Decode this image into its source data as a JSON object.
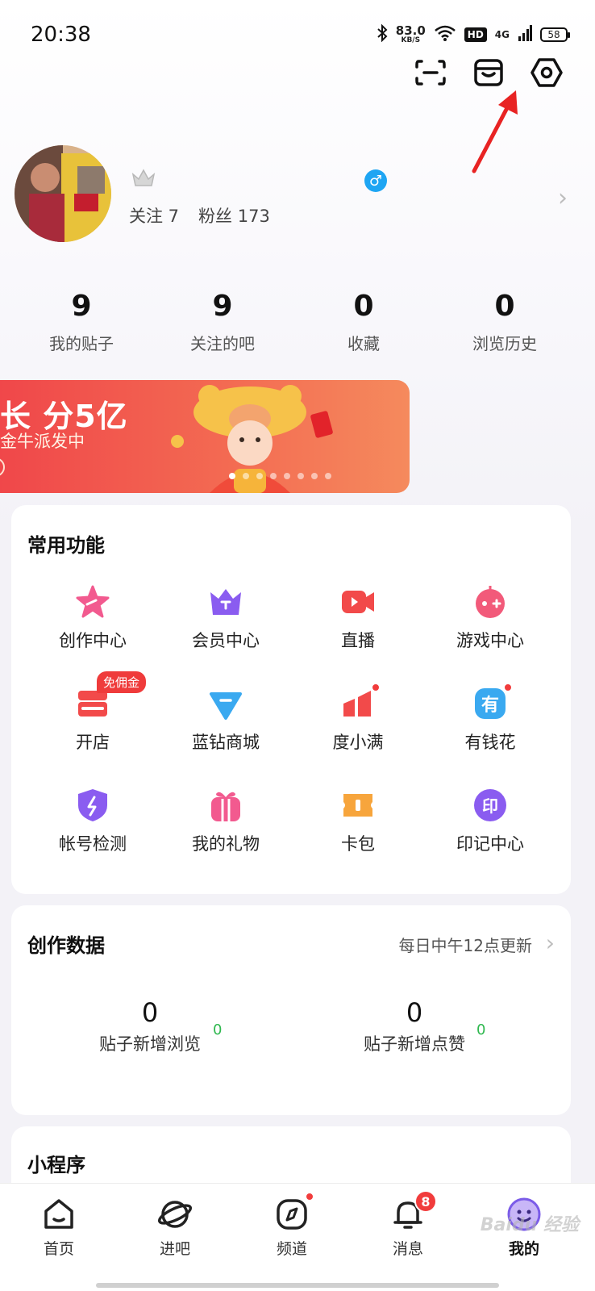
{
  "status_bar": {
    "time": "20:38",
    "speed_value": "83.0",
    "speed_unit": "KB/S",
    "hd": "HD",
    "network": "4G",
    "battery": "58"
  },
  "top_icons": [
    "scan-icon",
    "store-icon",
    "settings-icon"
  ],
  "profile": {
    "follow_label": "关注 7",
    "fans_label": "粉丝 173",
    "gender_symbol": "♂"
  },
  "stats": [
    {
      "value": "9",
      "label": "我的贴子"
    },
    {
      "value": "9",
      "label": "关注的吧"
    },
    {
      "value": "0",
      "label": "收藏"
    },
    {
      "value": "0",
      "label": "浏览历史"
    }
  ],
  "banner": {
    "title": "长 分5亿",
    "subtitle": "金牛派发中"
  },
  "functions": {
    "title": "常用功能",
    "promo_badge": "免佣金",
    "items": [
      {
        "label": "创作中心",
        "icon": "star-icon",
        "color": "#f25a8f"
      },
      {
        "label": "会员中心",
        "icon": "crown-icon",
        "color": "#8a5cf0"
      },
      {
        "label": "直播",
        "icon": "video-icon",
        "color": "#f24a4a"
      },
      {
        "label": "游戏中心",
        "icon": "gamepad-icon",
        "color": "#f25a7a"
      },
      {
        "label": "开店",
        "icon": "shop-icon",
        "color": "#f24a4a"
      },
      {
        "label": "蓝钻商城",
        "icon": "diamond-icon",
        "color": "#3aa9f0"
      },
      {
        "label": "度小满",
        "icon": "chart-icon",
        "color": "#f24a4a"
      },
      {
        "label": "有钱花",
        "icon": "money-icon",
        "color": "#3aa9f0"
      },
      {
        "label": "帐号检测",
        "icon": "shield-icon",
        "color": "#8a5cf0"
      },
      {
        "label": "我的礼物",
        "icon": "gift-icon",
        "color": "#f25a8f"
      },
      {
        "label": "卡包",
        "icon": "ticket-icon",
        "color": "#f7a53c"
      },
      {
        "label": "印记中心",
        "icon": "stamp-icon",
        "color": "#8a5cf0"
      }
    ]
  },
  "creation_data": {
    "title": "创作数据",
    "update_note": "每日中午12点更新",
    "items": [
      {
        "value": "0",
        "delta": "0",
        "label": "贴子新增浏览"
      },
      {
        "value": "0",
        "delta": "0",
        "label": "贴子新增点赞"
      }
    ]
  },
  "mini_programs": {
    "title": "小程序"
  },
  "bottom_nav": [
    {
      "label": "首页",
      "icon": "home-icon"
    },
    {
      "label": "进吧",
      "icon": "planet-icon"
    },
    {
      "label": "频道",
      "icon": "compass-icon"
    },
    {
      "label": "消息",
      "icon": "bell-icon",
      "badge": "8"
    },
    {
      "label": "我的",
      "icon": "face-icon"
    }
  ],
  "watermark": "Baidu 经验"
}
